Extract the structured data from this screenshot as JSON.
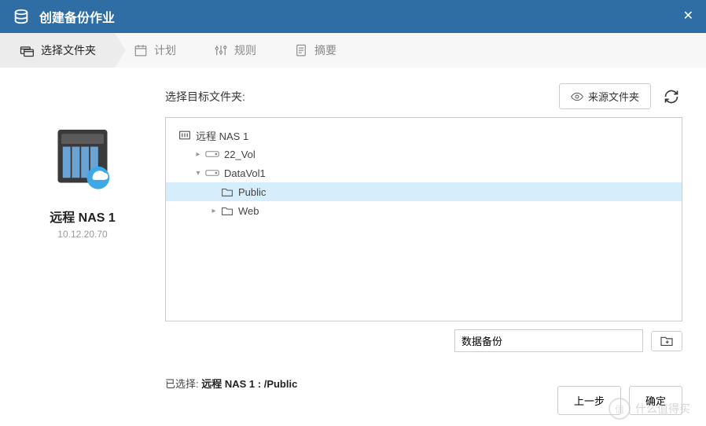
{
  "title": "创建备份作业",
  "steps": {
    "select_folder": "选择文件夹",
    "schedule": "计划",
    "rules": "规则",
    "summary": "摘要"
  },
  "device": {
    "name": "远程 NAS 1",
    "ip": "10.12.20.70"
  },
  "labels": {
    "select_target": "选择目标文件夹:",
    "source_folder": "来源文件夹",
    "selected_prefix": "已选择:",
    "back": "上一步",
    "confirm": "确定"
  },
  "tree": {
    "root": "远程 NAS 1",
    "vol1": "22_Vol",
    "vol2": "DataVol1",
    "folder_public": "Public",
    "folder_web": "Web"
  },
  "input": {
    "value": "数据备份"
  },
  "selected_path": "远程 NAS 1 : /Public",
  "watermark": "什么值得买"
}
